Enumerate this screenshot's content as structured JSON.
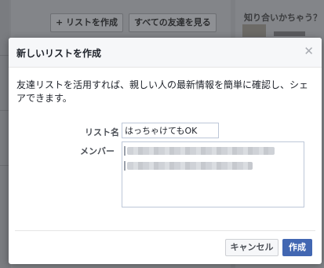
{
  "background": {
    "add_list_button": "+ リストを作成",
    "all_friends_button": "すべての友達を見る",
    "sidebar_title": "知り合いかちゃう？"
  },
  "dialog": {
    "title": "新しいリストを作成",
    "description": "友達リストを活用すれば、親しい人の最新情報を簡単に確認し、シェアできます。",
    "list_name_label": "リスト名",
    "list_name_value": "はっちゃけてもOK",
    "members_label": "メンバー",
    "cancel_label": "キャンセル",
    "create_label": "作成"
  },
  "colors": {
    "primary_button": "#4267b2",
    "overlay": "#7f8185"
  },
  "icons": {
    "close": "close-icon"
  }
}
